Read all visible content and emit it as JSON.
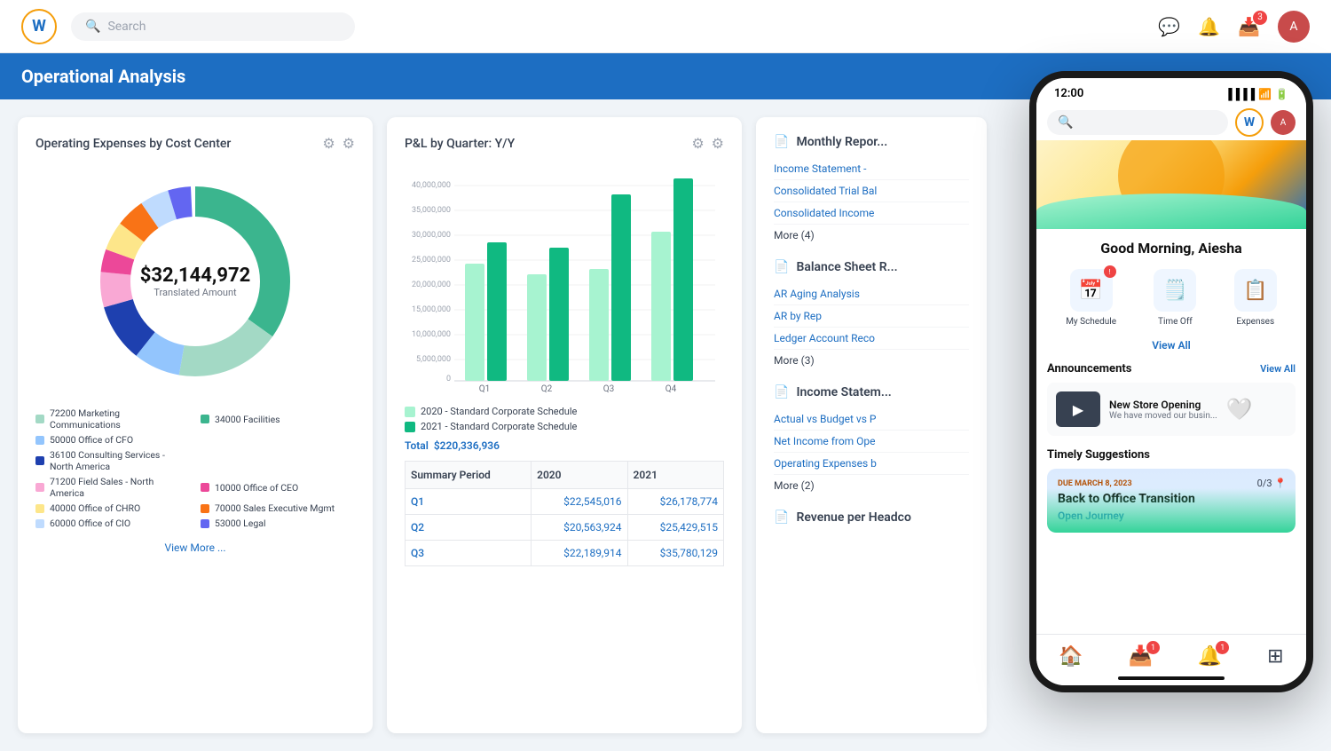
{
  "app": {
    "name": "Workday",
    "logo_letter": "W"
  },
  "nav": {
    "search_placeholder": "Search",
    "notification_badge": "3",
    "avatar_initials": "A"
  },
  "page_title": "Operational Analysis",
  "cards": {
    "donut": {
      "title": "Operating Expenses by Cost Center",
      "amount": "$32,144,972",
      "subtitle": "Translated Amount",
      "view_more": "View More ...",
      "legend": [
        {
          "label": "72200 Marketing Communications",
          "color": "#a3d9c5"
        },
        {
          "label": "34000 Facilities",
          "color": "#3bb58e"
        },
        {
          "label": "50000 Office of CFO",
          "color": "#93c5fd"
        },
        {
          "label": "",
          "color": ""
        },
        {
          "label": "36100 Consulting Services - North America",
          "color": "#1e40af"
        },
        {
          "label": "",
          "color": ""
        },
        {
          "label": "71200 Field Sales - North America",
          "color": "#f9a8d4"
        },
        {
          "label": "10000 Office of CEO",
          "color": "#ec4899"
        },
        {
          "label": "40000 Office of CHRO",
          "color": "#fde68a"
        },
        {
          "label": "70000 Sales Executive Mgmt",
          "color": "#f97316"
        },
        {
          "label": "60000 Office of CIO",
          "color": "#bfdbfe"
        },
        {
          "label": "53000 Legal",
          "color": "#6366f1"
        }
      ],
      "segments": [
        {
          "color": "#3bb58e",
          "pct": 35
        },
        {
          "color": "#a3d9c5",
          "pct": 18
        },
        {
          "color": "#93c5fd",
          "pct": 8
        },
        {
          "color": "#1e40af",
          "pct": 10
        },
        {
          "color": "#f9a8d4",
          "pct": 6
        },
        {
          "color": "#ec4899",
          "pct": 4
        },
        {
          "color": "#fde68a",
          "pct": 5
        },
        {
          "color": "#f97316",
          "pct": 5
        },
        {
          "color": "#bfdbfe",
          "pct": 5
        },
        {
          "color": "#6366f1",
          "pct": 4
        }
      ]
    },
    "bar": {
      "title": "P&L by Quarter: Y/Y",
      "bars": [
        {
          "label": "Q1",
          "val2020": 22,
          "val2021": 26
        },
        {
          "label": "Q2",
          "val2020": 20,
          "val2021": 25
        },
        {
          "label": "Q3",
          "val2020": 21,
          "val2021": 35
        },
        {
          "label": "Q4",
          "val2020": 28,
          "val2021": 38
        }
      ],
      "y_labels": [
        "40,000,000",
        "35,000,000",
        "30,000,000",
        "25,000,000",
        "20,000,000",
        "15,000,000",
        "10,000,000",
        "5,000,000",
        "0"
      ],
      "legend_2020": "2020 - Standard Corporate Schedule",
      "legend_2021": "2021 - Standard Corporate Schedule",
      "total_label": "Total",
      "total_value": "$220,336,936",
      "color_2020": "#a7f3d0",
      "color_2021": "#10b981",
      "table": {
        "headers": [
          "Summary Period",
          "2020",
          "2021"
        ],
        "rows": [
          {
            "period": "Q1",
            "v2020": "$22,545,016",
            "v2021": "$26,178,774"
          },
          {
            "period": "Q2",
            "v2020": "$20,563,924",
            "v2021": "$25,429,515"
          },
          {
            "period": "Q3",
            "v2020": "$22,189,914",
            "v2021": "$35,780,129"
          }
        ]
      }
    },
    "reports": {
      "monthly_title": "Monthly Repor...",
      "items1": [
        "Income Statement -",
        "Consolidated Trial Bal",
        "Consolidated Income",
        "More (4)"
      ],
      "balance_title": "Balance Sheet R...",
      "items2": [
        "AR Aging Analysis",
        "AR by Rep",
        "Ledger Account Reco",
        "More (3)"
      ],
      "income_title": "Income Statem...",
      "items3": [
        "Actual vs Budget vs P",
        "Net Income from Ope",
        "Operating Expenses b",
        "More (2)"
      ],
      "revenue_title": "Revenue per Headco"
    }
  },
  "mobile": {
    "time": "12:00",
    "greeting": "Good Morning, Aiesha",
    "actions": [
      {
        "name": "my-schedule",
        "label": "My Schedule",
        "icon": "📅",
        "badge": false
      },
      {
        "name": "time-off",
        "label": "Time Off",
        "icon": "🗒️",
        "badge": false
      },
      {
        "name": "expenses",
        "label": "Expenses",
        "icon": "📋",
        "badge": false
      }
    ],
    "view_all": "View All",
    "announcements_title": "Announcements",
    "announcements_view_all": "View All",
    "announcement": {
      "title": "New Store Opening",
      "body": "We have moved our busin..."
    },
    "timely_title": "Timely Suggestions",
    "timely_progress": "0/3",
    "due_label": "DUE MARCH 8, 2023",
    "journey_title": "Back to Office Transition",
    "open_journey": "Open Journey",
    "bottom_nav": {
      "home_badge": "",
      "inbox_badge": "1",
      "bell_badge": "1"
    }
  }
}
